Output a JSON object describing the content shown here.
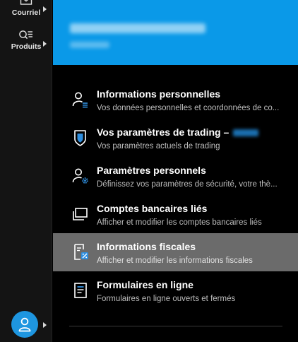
{
  "rail": {
    "items": [
      {
        "label": "Courriel",
        "icon": "mail-icon"
      },
      {
        "label": "Produits",
        "icon": "products-search-icon"
      }
    ],
    "avatar_icon": "user-icon"
  },
  "header": {
    "account_name": "",
    "account_sub": ""
  },
  "menu": {
    "items": [
      {
        "title": "Informations personnelles",
        "desc": "Vos données personnelles et coordonnées de co...",
        "icon": "person-list-icon",
        "active": false
      },
      {
        "title": "Vos paramètres de trading –",
        "desc": "Vos paramètres actuels de trading",
        "icon": "shield-icon",
        "active": false
      },
      {
        "title": "Paramètres personnels",
        "desc": "Définissez vos paramètres de sécurité, votre thè...",
        "icon": "person-gear-icon",
        "active": false
      },
      {
        "title": "Comptes bancaires liés",
        "desc": "Afficher et modifier les comptes bancaires liés",
        "icon": "linked-windows-icon",
        "active": false
      },
      {
        "title": "Informations fiscales",
        "desc": "Afficher et modifier les informations fiscales",
        "icon": "tax-document-icon",
        "active": true
      },
      {
        "title": "Formulaires en ligne",
        "desc": "Formulaires en ligne ouverts et fermés",
        "icon": "form-document-icon",
        "active": false
      }
    ]
  },
  "colors": {
    "accent": "#0a99e8",
    "avatar": "#1e96e0",
    "active_row": "#6b6b6b",
    "icon_accent": "#2f8fe0"
  }
}
